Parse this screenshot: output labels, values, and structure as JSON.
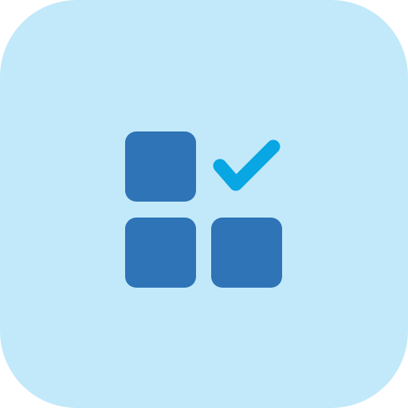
{
  "icon": {
    "name": "grid-check-icon",
    "colors": {
      "background": "#C2E9FA",
      "tiles": "#2E74B6",
      "checkmark": "#08A6E3"
    }
  }
}
